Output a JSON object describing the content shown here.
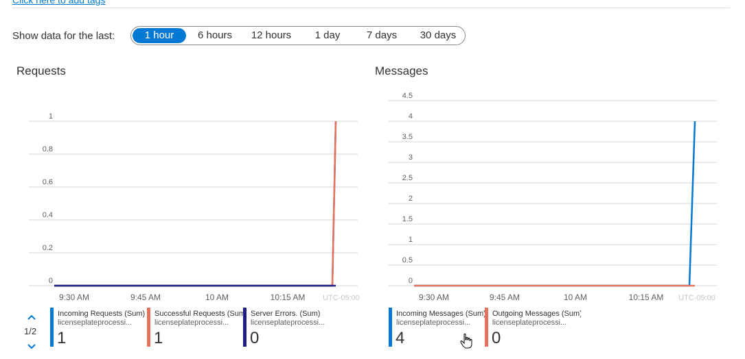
{
  "tags": {
    "link_label": "Click here to add tags"
  },
  "time_range": {
    "label": "Show data for the last:",
    "options": [
      "1 hour",
      "6 hours",
      "12 hours",
      "1 day",
      "7 days",
      "30 days"
    ],
    "selected": "1 hour"
  },
  "colors": {
    "accent": "#0078d4",
    "incoming": "#0078d4",
    "successful": "#e8715b",
    "server_errors": "#1d1c85"
  },
  "requests_chart": {
    "title": "Requests",
    "timezone": "UTC-05:00",
    "y_ticks": [
      "1",
      "0.8",
      "0.6",
      "0.4",
      "0.2",
      "0"
    ],
    "x_ticks": [
      "9:30 AM",
      "9:45 AM",
      "10 AM",
      "10:15 AM"
    ]
  },
  "messages_chart": {
    "title": "Messages",
    "timezone": "UTC-05:00",
    "y_ticks": [
      "4.5",
      "4",
      "3.5",
      "3",
      "2.5",
      "2",
      "1.5",
      "1",
      "0.5",
      "0"
    ],
    "x_ticks": [
      "9:30 AM",
      "9:45 AM",
      "10 AM",
      "10:15 AM"
    ]
  },
  "chart_data": [
    {
      "type": "line",
      "title": "Requests",
      "xlabel": "",
      "ylabel": "",
      "ylim": [
        0,
        1
      ],
      "x_ticks": [
        "9:30 AM",
        "9:45 AM",
        "10 AM",
        "10:15 AM"
      ],
      "series": [
        {
          "name": "Incoming Requests (Sum)",
          "color": "#0078d4",
          "values": [
            0,
            0,
            0,
            0,
            0,
            1
          ]
        },
        {
          "name": "Successful Requests (Sum)",
          "color": "#e8715b",
          "values": [
            0,
            0,
            0,
            0,
            0,
            1
          ]
        },
        {
          "name": "Server Errors. (Sum)",
          "color": "#1d1c85",
          "values": [
            0,
            0,
            0,
            0,
            0,
            0
          ]
        }
      ]
    },
    {
      "type": "line",
      "title": "Messages",
      "xlabel": "",
      "ylabel": "",
      "ylim": [
        0,
        4.5
      ],
      "x_ticks": [
        "9:30 AM",
        "9:45 AM",
        "10 AM",
        "10:15 AM"
      ],
      "series": [
        {
          "name": "Incoming Messages (Sum)",
          "color": "#0078d4",
          "values": [
            0,
            0,
            0,
            0,
            0,
            4
          ]
        },
        {
          "name": "Outgoing Messages (Sum)",
          "color": "#e8715b",
          "values": [
            0,
            0,
            0,
            0,
            0,
            0
          ]
        }
      ]
    }
  ],
  "requests_legend": {
    "pager": {
      "text": "1/2"
    },
    "items": [
      {
        "name": "Incoming Requests (Sum)",
        "resource": "licenseplateprocessi...",
        "value": "1"
      },
      {
        "name": "Successful Requests (Sum)",
        "resource": "licenseplateprocessi...",
        "value": "1"
      },
      {
        "name": "Server Errors. (Sum)",
        "resource": "licenseplateprocessi...",
        "value": "0"
      }
    ]
  },
  "messages_legend": {
    "items": [
      {
        "name": "Incoming Messages (Sum)",
        "resource": "licenseplateprocessi...",
        "value": "4"
      },
      {
        "name": "Outgoing Messages (Sum)",
        "resource": "licenseplateprocessi...",
        "value": "0"
      }
    ]
  }
}
